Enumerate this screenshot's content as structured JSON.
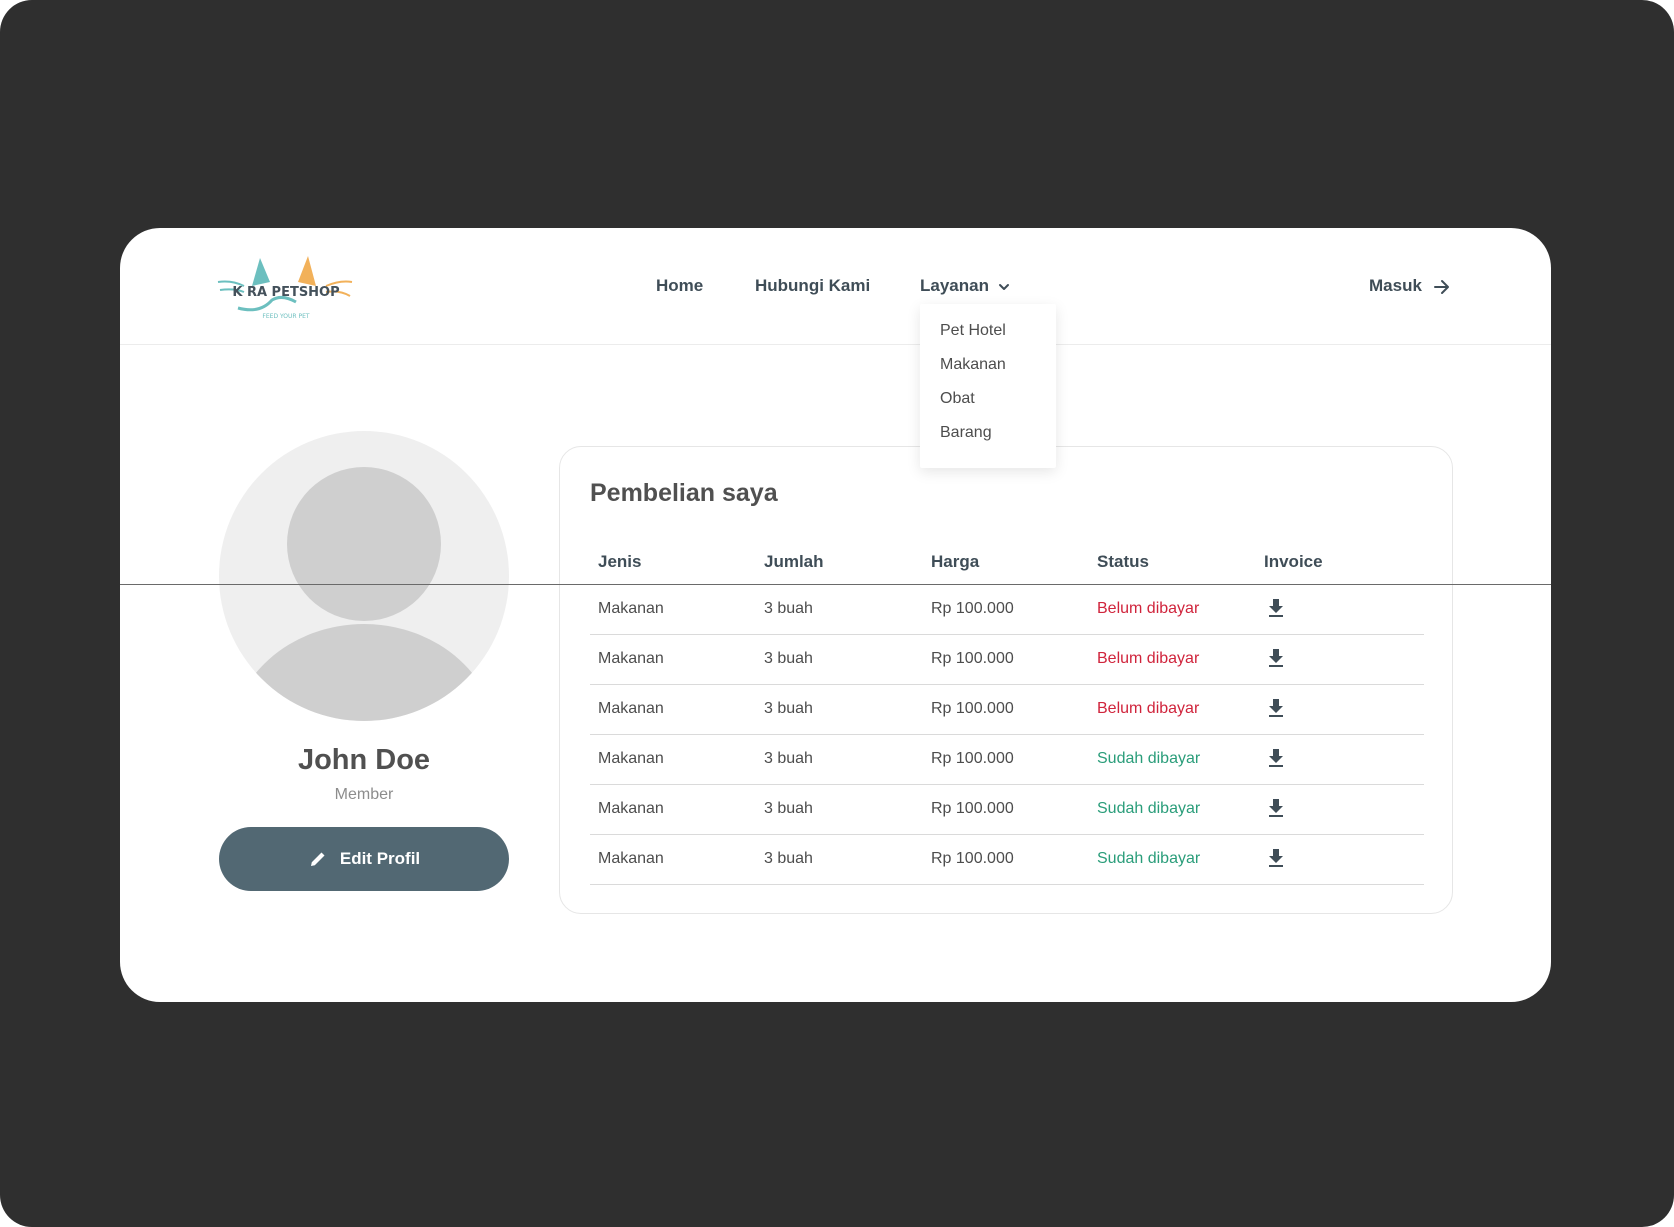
{
  "brand": {
    "logo_text": "K RA PETSHOP",
    "tagline": "FEED YOUR PET",
    "colors": {
      "teal": "#6cbfbf",
      "orange": "#f2b15a"
    }
  },
  "nav": {
    "home": "Home",
    "contact": "Hubungi Kami",
    "services": "Layanan",
    "login": "Masuk"
  },
  "dropdown": {
    "items": [
      "Pet Hotel",
      "Makanan",
      "Obat",
      "Barang"
    ]
  },
  "profile": {
    "name": "John Doe",
    "role": "Member",
    "edit_label": "Edit Profil"
  },
  "purchases": {
    "title": "Pembelian saya",
    "columns": [
      "Jenis",
      "Jumlah",
      "Harga",
      "Status",
      "Invoice"
    ],
    "rows": [
      {
        "type": "Makanan",
        "qty": "3 buah",
        "price": "Rp 100.000",
        "status": "Belum dibayar"
      },
      {
        "type": "Makanan",
        "qty": "3 buah",
        "price": "Rp 100.000",
        "status": "Belum dibayar"
      },
      {
        "type": "Makanan",
        "qty": "3 buah",
        "price": "Rp 100.000",
        "status": "Belum dibayar"
      },
      {
        "type": "Makanan",
        "qty": "3 buah",
        "price": "Rp 100.000",
        "status": "Sudah dibayar"
      },
      {
        "type": "Makanan",
        "qty": "3 buah",
        "price": "Rp 100.000",
        "status": "Sudah dibayar"
      },
      {
        "type": "Makanan",
        "qty": "3 buah",
        "price": "Rp 100.000",
        "status": "Sudah dibayar"
      }
    ]
  },
  "colors": {
    "unpaid": "#d0243c",
    "paid": "#2a9d7a",
    "button": "#526873"
  }
}
